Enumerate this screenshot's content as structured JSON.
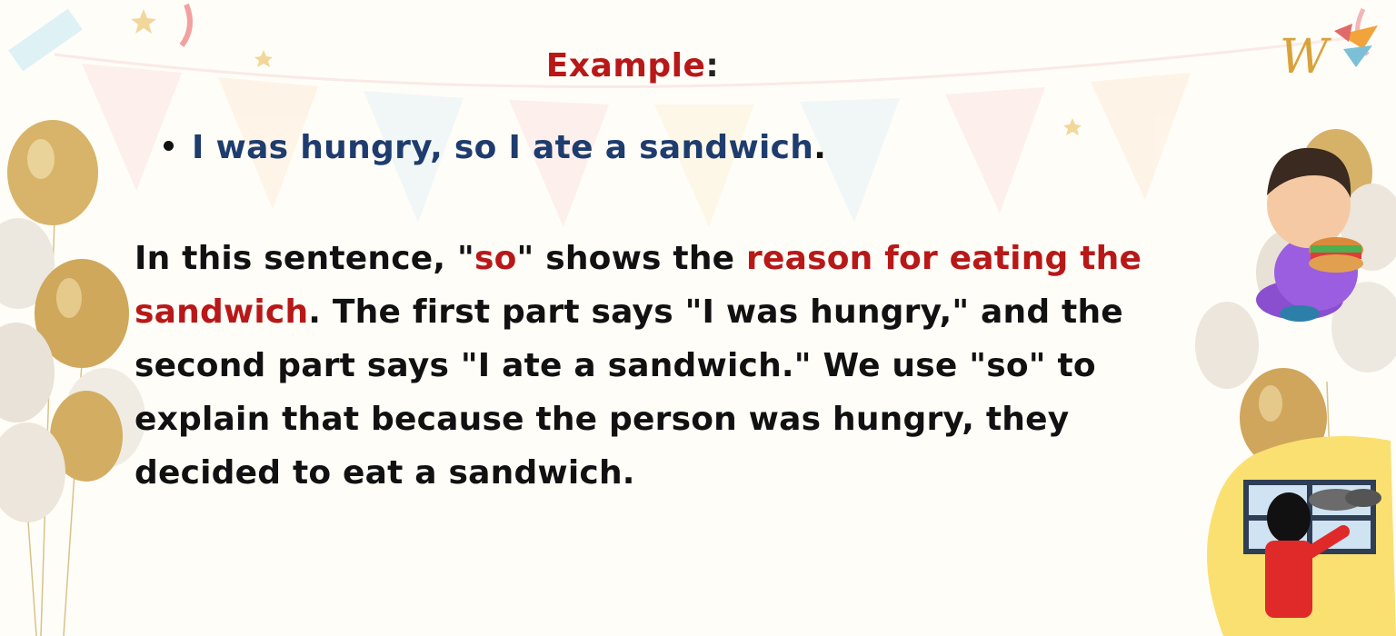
{
  "heading": {
    "word": "Example",
    "colon": ":"
  },
  "bullet": {
    "text": "I was hungry, so I ate a sandwich",
    "end": "."
  },
  "paragraph": {
    "p1": "In this sentence, \"",
    "p2": "so",
    "p3": "\" shows the ",
    "p4": "reason for eating the sandwich",
    "p5": ". The first part says \"I was hungry,\" and the second part says \"I ate a sandwich.\" We use \"so\" to explain that because the person was hungry, they decided to eat a sandwich."
  },
  "colors": {
    "heading": "#b81818",
    "bullet": "#1e3c6e",
    "highlight": "#b81818",
    "body": "#111111"
  },
  "decorations": {
    "left": "gold-balloons",
    "bottom_right": "child-looking-out-rainy-window",
    "right": "child-eating-sandwich-illustration",
    "top_right": "brand-logo-w",
    "background": "party-bunting-and-confetti"
  }
}
